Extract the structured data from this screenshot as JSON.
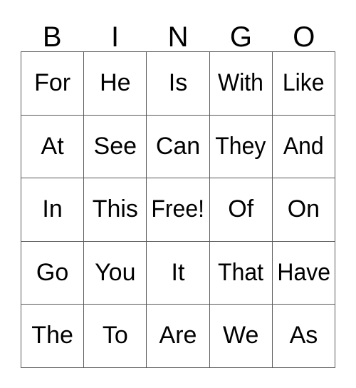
{
  "card": {
    "header": {
      "letters": [
        "B",
        "I",
        "N",
        "G",
        "O"
      ]
    },
    "free_space_label": "Free!",
    "grid": {
      "columns": 5,
      "rows": 5,
      "cells": [
        [
          "For",
          "He",
          "Is",
          "With",
          "Like"
        ],
        [
          "At",
          "See",
          "Can",
          "They",
          "And"
        ],
        [
          "In",
          "This",
          "Free!",
          "Of",
          "On"
        ],
        [
          "Go",
          "You",
          "It",
          "That",
          "Have"
        ],
        [
          "The",
          "To",
          "Are",
          "We",
          "As"
        ]
      ]
    },
    "colors": {
      "background": "#ffffff",
      "text": "#000000",
      "border": "#595959"
    }
  }
}
